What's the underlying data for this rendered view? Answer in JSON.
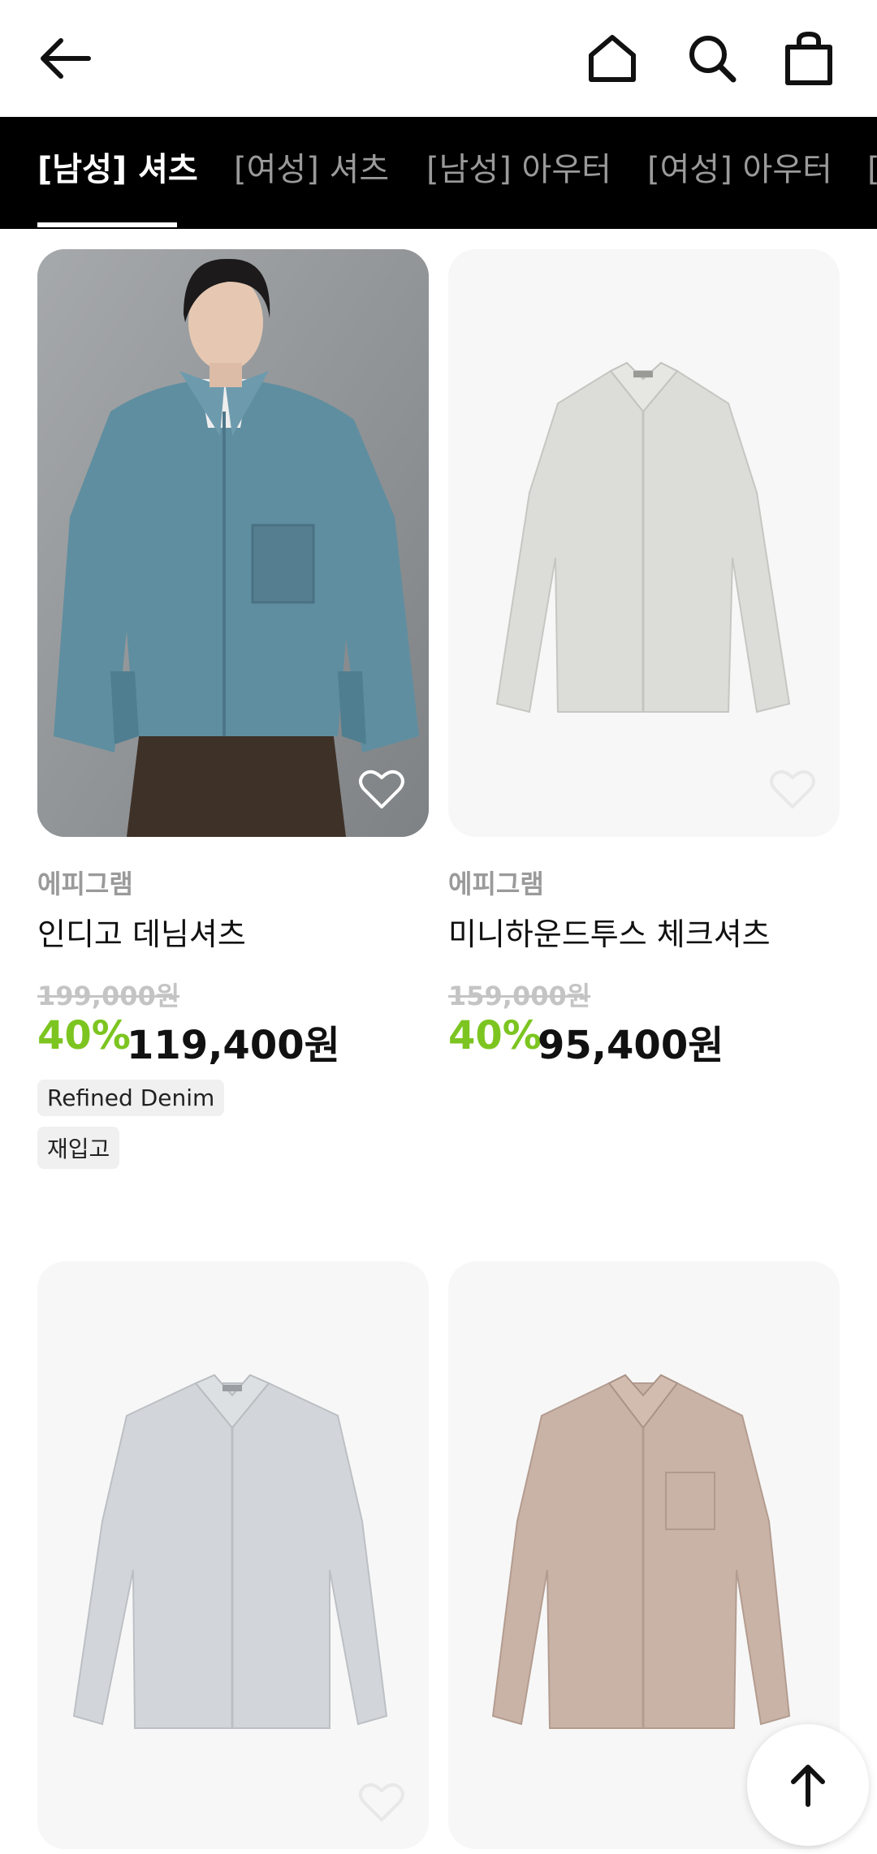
{
  "header": {
    "back_icon": "arrow-left-icon",
    "home_icon": "home-icon",
    "search_icon": "search-icon",
    "cart_icon": "shopping-bag-icon"
  },
  "tabs": [
    {
      "label": "[남성] 셔츠",
      "active": true
    },
    {
      "label": "[여성] 셔츠",
      "active": false
    },
    {
      "label": "[남성] 아우터",
      "active": false
    },
    {
      "label": "[여성] 아우터",
      "active": false
    },
    {
      "label": "[",
      "active": false
    }
  ],
  "products": [
    {
      "brand": "에피그램",
      "name": "인디고 데님셔츠",
      "original_price": "199,000원",
      "discount": "40%",
      "price": "119,400원",
      "tags": [
        "Refined Denim",
        "재입고"
      ]
    },
    {
      "brand": "에피그램",
      "name": "미니하운드투스 체크셔츠",
      "original_price": "159,000원",
      "discount": "40%",
      "price": "95,400원",
      "tags": []
    },
    {
      "brand": "",
      "name": "",
      "original_price": "",
      "discount": "",
      "price": "",
      "tags": []
    },
    {
      "brand": "",
      "name": "",
      "original_price": "",
      "discount": "",
      "price": "",
      "tags": []
    }
  ],
  "colors": {
    "accent_green": "#7cc520",
    "tab_bar": "#000000",
    "denim": "#5f8ea0",
    "light_grey_shirt": "#dcdcd8",
    "blue_grey_shirt": "#d2d6da",
    "beige_shirt": "#c9b2a6"
  },
  "fab": {
    "icon": "arrow-up-icon"
  }
}
